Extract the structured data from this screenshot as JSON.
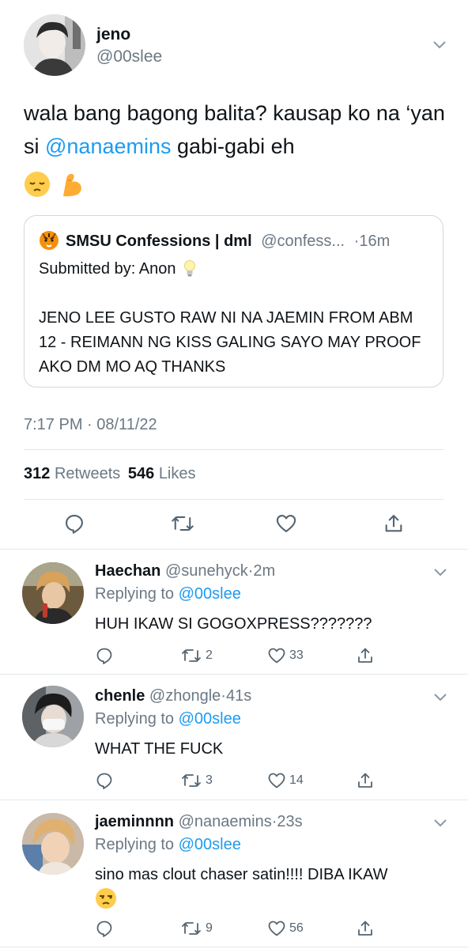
{
  "tweet": {
    "name": "jeno",
    "handle": "@00slee",
    "text_before": "wala bang bagong balita? kausap ko na ‘yan si ",
    "mention": "@nanaemins",
    "text_after": " gabi-gabi eh",
    "emojis": [
      "pensive-face",
      "flexed-biceps"
    ],
    "quote": {
      "name": "SMSU Confessions | dml",
      "handle": "@confess...",
      "time": "·16m",
      "submitted": "Submitted by: Anon",
      "body": "JENO LEE GUSTO RAW NI NA JAEMIN FROM ABM 12 - REIMANN NG KISS GALING SAYO MAY PROOF AKO DM MO AQ THANKS"
    },
    "timestamp": "7:17 PM · 08/11/22",
    "retweets": "312",
    "retweets_label": "Retweets",
    "likes": "546",
    "likes_label": "Likes"
  },
  "replies": [
    {
      "name": "Haechan",
      "handle": "@sunehyck",
      "time": "·2m",
      "replying_label": "Replying to ",
      "replying_to": "@00slee",
      "text": "HUH IKAW SI GOGOXPRESS???????",
      "retweets": "2",
      "likes": "33"
    },
    {
      "name": "chenle",
      "handle": "@zhongle",
      "time": "·41s",
      "replying_label": "Replying to ",
      "replying_to": "@00slee",
      "text": "WHAT THE FUCK",
      "retweets": "3",
      "likes": "14"
    },
    {
      "name": "jaeminnnn",
      "handle": "@nanaemins",
      "time": "·23s",
      "replying_label": "Replying to ",
      "replying_to": "@00slee",
      "text": "sino mas clout chaser satin!!!! DIBA IKAW",
      "emoji": "unamused-face",
      "retweets": "9",
      "likes": "56"
    }
  ],
  "colors": {
    "accent": "#1d9bf0",
    "muted": "#6b7884",
    "border": "#cfd9de"
  }
}
